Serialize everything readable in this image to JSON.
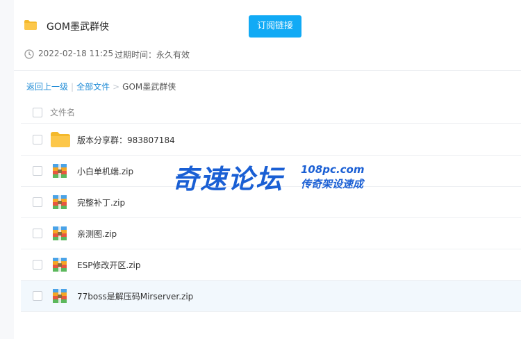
{
  "share": {
    "title": "GOM墨武群侠",
    "subscribe_label": "订阅链接",
    "date": "2022-02-18 11:25",
    "expire_label": "过期时间：永久有效"
  },
  "breadcrumb": {
    "back": "返回上一级",
    "all_files": "全部文件",
    "current": "GOM墨武群侠",
    "sep1": "|",
    "sep2": ">"
  },
  "table": {
    "header_label": "文件名",
    "rows": [
      {
        "name": "版本分享群：983807184",
        "type": "folder"
      },
      {
        "name": "小白单机端.zip",
        "type": "zip"
      },
      {
        "name": "完整补丁.zip",
        "type": "zip"
      },
      {
        "name": "亲测图.zip",
        "type": "zip"
      },
      {
        "name": "ESP修改开区.zip",
        "type": "zip"
      },
      {
        "name": "77boss是解压码Mirserver.zip",
        "type": "zip"
      }
    ]
  },
  "watermark": {
    "main": "奇速论坛",
    "url": "108pc.com",
    "slogan": "传奇架设速成"
  },
  "colors": {
    "accent": "#11aaf5",
    "link": "#1e8bd6",
    "folder": "#fcc74a",
    "watermark": "#1a5fd4"
  }
}
